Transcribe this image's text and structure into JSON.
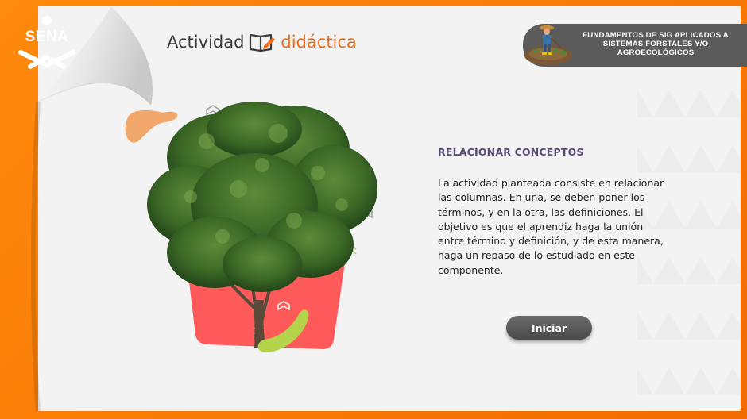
{
  "brand": {
    "logo_text": "SENA"
  },
  "header": {
    "title_part1": "Actividad",
    "title_part2": "didáctica",
    "course_title": "FUNDAMENTOS DE SIG APLICADOS A SISTEMAS FORSTALES Y/O AGROECOLÓGICOS"
  },
  "content": {
    "heading": "RELACIONAR CONCEPTOS",
    "description": "La actividad planteada consiste en relacionar las columnas. En una, se deben poner los términos, y en la otra, las definiciones. El objetivo es que el aprendiz haga la unión entre término y definición, y de esta manera, haga un repaso de lo estudiado en este componente.",
    "start_button": "Iniciar"
  },
  "colors": {
    "frame_orange": "#f77f00",
    "title_accent": "#ef6a1a",
    "heading_purple": "#5a4a7a",
    "course_banner": "#5b5b5b",
    "button_gray": "#5a5a5a",
    "card_coral": "#ff5a5a",
    "leaf_green": "#b5d34a"
  },
  "icons": [
    "sena-logo-icon",
    "book-pencil-icon",
    "farmer-icon",
    "tree-illustration"
  ]
}
